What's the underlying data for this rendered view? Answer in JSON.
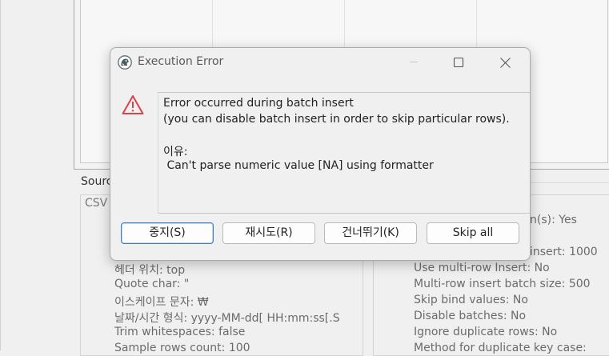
{
  "background": {
    "source_label": "Sourc",
    "csv_label": "CSV",
    "left_settings": [
      "헤더 위치: top",
      "Quote char: \"",
      "이스케이프 문자: ₩",
      "날짜/시간 형식: yyyy-MM-dd[ HH:mm:ss[.S",
      "Trim whitespaces: false",
      "Sample rows count: 100"
    ],
    "right_settings_partial": [
      "n(s): Yes",
      "insert: 1000"
    ],
    "right_settings": [
      "Use multi-row Insert: No",
      "Multi-row insert batch size: 500",
      "Skip bind values: No",
      "Disable batches: No",
      "Ignore duplicate rows: No",
      "Method for duplicate key case:"
    ]
  },
  "dialog": {
    "title": "Execution Error",
    "icon": "app-logo-icon",
    "error_icon": "warning-triangle-icon",
    "error_color": "#d9434b",
    "accent_color": "#3f7ec4",
    "message": {
      "line1": "Error occurred during batch insert",
      "line2": "(you can disable batch insert in order to skip particular rows).",
      "reason_label": "이유:",
      "reason_text": " Can't parse numeric value [NA] using formatter"
    },
    "buttons": {
      "stop": "중지(S)",
      "retry": "재시도(R)",
      "skip": "건너뛰기(K)",
      "skip_all": "Skip all"
    }
  }
}
